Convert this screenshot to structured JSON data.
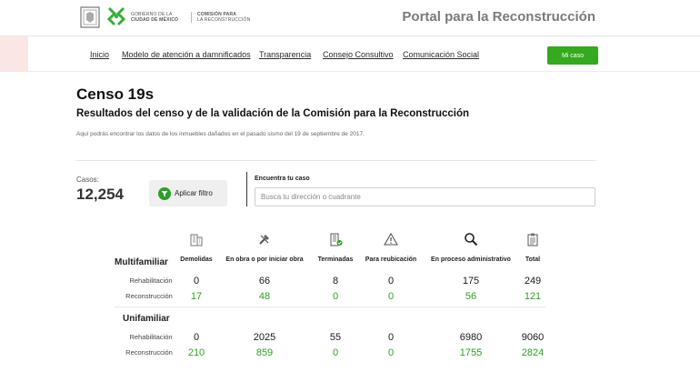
{
  "header": {
    "gov_line1": "GOBIERNO DE LA",
    "gov_line2": "CIUDAD DE MÉXICO",
    "comm_line1": "COMISIÓN PARA",
    "comm_line2": "LA RECONSTRUCCIÓN",
    "portal_title": "Portal para la Reconstrucción"
  },
  "nav": {
    "items": [
      {
        "label": "Inicio"
      },
      {
        "label": "Modelo de atención a damnificados"
      },
      {
        "label": "Transparencia"
      },
      {
        "label": "Consejo Consultivo"
      },
      {
        "label": "Comunicación Social"
      }
    ],
    "mi_caso": "Mi caso"
  },
  "page": {
    "title": "Censo 19s",
    "subtitle": "Resultados del censo y de la validación de la Comisión para la Reconstrucción",
    "description": "Aquí podrás encontrar los datos de los inmuebles dañados en el pasado sismo del 19 de septiembre de 2017."
  },
  "stats": {
    "casos_label": "Casos:",
    "casos_value": "12,254",
    "filter_label": "Aplicar filtro"
  },
  "search": {
    "label": "Encuentra tu caso",
    "placeholder": "Busca tu dirección o cuadrante"
  },
  "table": {
    "columns": [
      {
        "label": "Demolidas",
        "icon": "building-icon"
      },
      {
        "label": "En obra o por iniciar obra",
        "icon": "tools-icon"
      },
      {
        "label": "Terminadas",
        "icon": "finished-building-icon"
      },
      {
        "label": "Para reubicación",
        "icon": "warning-icon"
      },
      {
        "label": "En proceso administrativo",
        "icon": "search-icon"
      },
      {
        "label": "Total",
        "icon": "clipboard-icon"
      }
    ],
    "groups": [
      {
        "title": "Multifamiliar",
        "rows": [
          {
            "label": "Rehabilitación",
            "values": [
              "0",
              "66",
              "8",
              "0",
              "175",
              "249"
            ]
          },
          {
            "label": "Reconstrucción",
            "values": [
              "17",
              "48",
              "0",
              "0",
              "56",
              "121"
            ]
          }
        ]
      },
      {
        "title": "Unifamiliar",
        "rows": [
          {
            "label": "Rehabilitación",
            "values": [
              "0",
              "2025",
              "55",
              "0",
              "6980",
              "9060"
            ]
          },
          {
            "label": "Reconstrucción",
            "values": [
              "210",
              "859",
              "0",
              "0",
              "1755",
              "2824"
            ]
          }
        ]
      }
    ]
  },
  "colors": {
    "accent_green": "#35a91f",
    "value_green": "#2f9e27",
    "title_gray": "#7a7a7a"
  }
}
